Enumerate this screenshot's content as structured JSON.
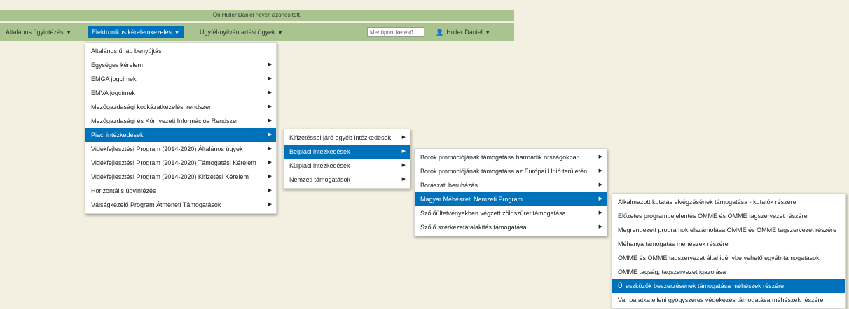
{
  "topbar": {
    "text": "Ön Huller Dániel néven azonosított."
  },
  "navbar": {
    "item1": "Általános ügyintézés",
    "item2": "Elektronikus kérelemkezelés",
    "item3": "Ügyfél-nyilvántartási ügyek",
    "search_value": "Menüpont kereső",
    "user": "Huller Dániel"
  },
  "menu1": {
    "items": [
      {
        "label": "Általános űrlap benyújtás"
      },
      {
        "label": "Egységes kérelem"
      },
      {
        "label": "EMGA jogcímek"
      },
      {
        "label": "EMVA jogcímek"
      },
      {
        "label": "Mezőgazdasági kockázatkezelési rendszer"
      },
      {
        "label": "Mezőgazdasági és Környezeti Információs Rendszer"
      },
      {
        "label": "Piaci intézkedések"
      },
      {
        "label": "Vidékfejlesztési Program (2014-2020) Általános ügyek"
      },
      {
        "label": "Vidékfejlesztési Program (2014-2020) Támogatási Kérelem"
      },
      {
        "label": "Vidékfejlesztési Program (2014-2020) Kifizetési Kérelem"
      },
      {
        "label": "Horizontális ügyintézés"
      },
      {
        "label": "Válságkezelő Program Átmeneti Támogatások"
      }
    ]
  },
  "menu2": {
    "items": [
      {
        "label": "Kifizetéssel járó egyéb intézkedések"
      },
      {
        "label": "Belpiaci intézkedések"
      },
      {
        "label": "Külpiaci intézkedések"
      },
      {
        "label": "Nemzeti támogatások"
      }
    ]
  },
  "menu3": {
    "items": [
      {
        "label": "Borok promóciójának támogatása harmadik országokban"
      },
      {
        "label": "Borok promóciójának támogatása az Európai Unió területén"
      },
      {
        "label": "Borászati beruházás"
      },
      {
        "label": "Magyar Méhészeti Nemzeti Program"
      },
      {
        "label": "Szőlőültetvényekben végzett zöldszüret támogatása"
      },
      {
        "label": "Szőlő szerkezetátalakítás támogatása"
      }
    ]
  },
  "menu4": {
    "items": [
      {
        "label": "Alkalmazott kutatás elvégzésének támogatása - kutatók részére"
      },
      {
        "label": "Előzetes programbejelentés OMME és OMME tagszervezet részére"
      },
      {
        "label": "Megrendezett programok elszámolása OMME és OMME tagszervezet részére"
      },
      {
        "label": "Méhanya támogatás méhészek részére"
      },
      {
        "label": "OMME és OMME tagszervezet által igénybe vehető egyéb támogatások"
      },
      {
        "label": "OMME tagság, tagszervezet igazolása"
      },
      {
        "label": "Új eszközök beszerzésének támogatása méhészek részére"
      },
      {
        "label": "Varroa atka elleni gyógyszeres védekezés támogatása méhészek részére"
      }
    ]
  },
  "icons": {
    "caret": "caret-down-icon",
    "arrow": "caret-right-icon",
    "user": "user-icon"
  },
  "colors": {
    "bar": "#a9c48f",
    "active": "#0072bc",
    "background": "#f4f0e1"
  }
}
